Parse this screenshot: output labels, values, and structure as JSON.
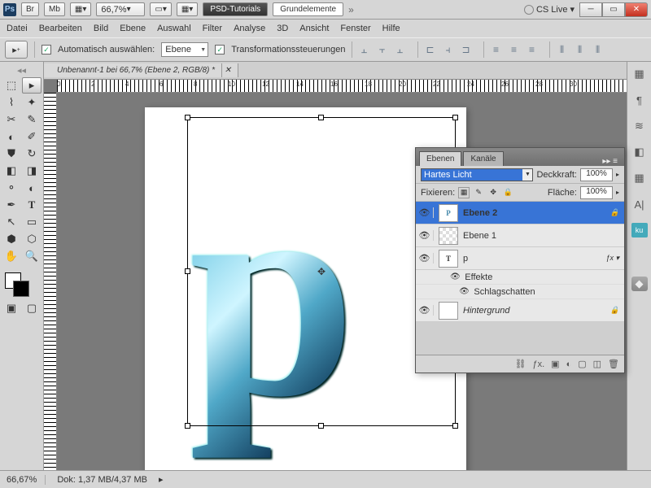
{
  "titlebar": {
    "zoom": "66,7%",
    "tab_dark": "PSD-Tutorials",
    "tab_light": "Grundelemente",
    "cslive": "CS Live",
    "br": "Br",
    "mb": "Mb"
  },
  "menu": [
    "Datei",
    "Bearbeiten",
    "Bild",
    "Ebene",
    "Auswahl",
    "Filter",
    "Analyse",
    "3D",
    "Ansicht",
    "Fenster",
    "Hilfe"
  ],
  "options": {
    "auto": "Automatisch auswählen:",
    "ebene": "Ebene",
    "trans": "Transformationssteuerungen"
  },
  "doc_tab": "Unbenannt-1 bei 66,7% (Ebene 2, RGB/8) *",
  "status": {
    "zoom": "66,67%",
    "info": "Dok: 1,37 MB/4,37 MB"
  },
  "panel": {
    "tabs": [
      "Ebenen",
      "Kanäle"
    ],
    "blend": "Hartes Licht",
    "opacity_lbl": "Deckkraft:",
    "opacity": "100%",
    "lock_lbl": "Fixieren:",
    "fill_lbl": "Fläche:",
    "fill": "100%",
    "layers": [
      {
        "name": "Ebene 2",
        "sel": true,
        "locked": true,
        "thumb": "P"
      },
      {
        "name": "Ebene 1",
        "checker": true
      },
      {
        "name": "p",
        "type": "T",
        "fx": true
      },
      {
        "name": "Hintergrund",
        "ital": true,
        "locked": true,
        "white": true
      }
    ],
    "effects": "Effekte",
    "shadow": "Schlagschatten"
  },
  "ruler": [
    0,
    2,
    4,
    6,
    8,
    10,
    12,
    14,
    16,
    18,
    20,
    22,
    24,
    26,
    28,
    30
  ]
}
